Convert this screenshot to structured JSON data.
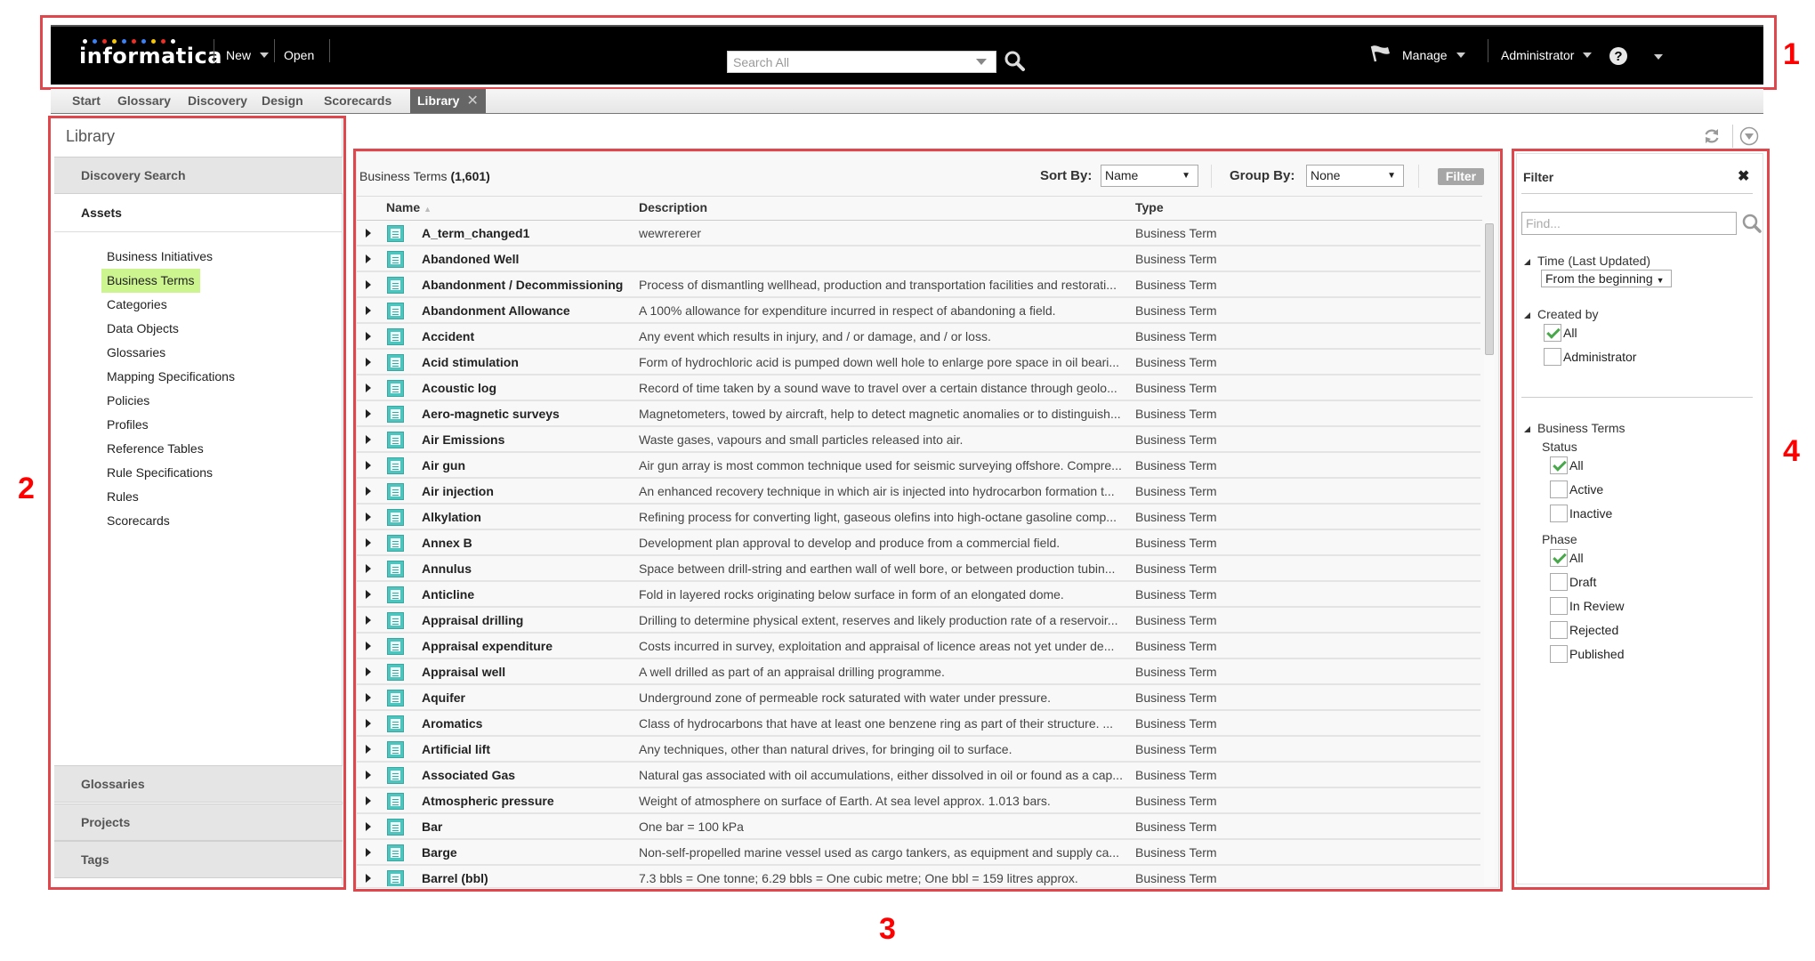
{
  "annotations": {
    "labels": [
      "1",
      "2",
      "3",
      "4"
    ]
  },
  "header": {
    "logo_text": "informatica",
    "logo_dot_colors": [
      "#ffffff",
      "#3b82f6",
      "#ef2e24",
      "#f7c600",
      "#3b82f6",
      "#ef2e24",
      "#3b82f6",
      "#f7c600",
      "#ef2e24",
      "#ffffff"
    ],
    "new_label": "New",
    "open_label": "Open",
    "search_placeholder": "Search All",
    "manage_label": "Manage",
    "user_label": "Administrator",
    "help_icon": "help-icon"
  },
  "tabs": [
    {
      "label": "Start"
    },
    {
      "label": "Glossary"
    },
    {
      "label": "Discovery"
    },
    {
      "label": "Design"
    },
    {
      "label": "Scorecards"
    },
    {
      "label": "Library",
      "active": true,
      "close": "✕"
    }
  ],
  "sidebar": {
    "title": "Library",
    "discovery_search": "Discovery Search",
    "assets": "Assets",
    "asset_items": [
      "Business Initiatives",
      "Business Terms",
      "Categories",
      "Data Objects",
      "Glossaries",
      "Mapping Specifications",
      "Policies",
      "Profiles",
      "Reference Tables",
      "Rule Specifications",
      "Rules",
      "Scorecards"
    ],
    "selected_item": "Business Terms",
    "bottom_sections": [
      "Glossaries",
      "Projects",
      "Tags"
    ],
    "highlight_color": "#ccf58f"
  },
  "main": {
    "title": "Business Terms",
    "count": "(1,601)",
    "sort_by_label": "Sort By:",
    "sort_by_value": "Name",
    "group_by_label": "Group By:",
    "group_by_value": "None",
    "filter_button": "Filter",
    "columns": {
      "name": "Name",
      "description": "Description",
      "type": "Type"
    },
    "rows": [
      {
        "name": "A_term_changed1",
        "description": " wewrererer",
        "type": "Business Term"
      },
      {
        "name": "Abandoned Well",
        "description": "",
        "type": "Business Term"
      },
      {
        "name": "Abandonment / Decommissioning",
        "description": "Process of dismantling wellhead, production and transportation facilities and restorati...",
        "type": "Business Term"
      },
      {
        "name": "Abandonment Allowance",
        "description": "A 100% allowance for expenditure incurred in respect of abandoning a field.",
        "type": "Business Term"
      },
      {
        "name": "Accident",
        "description": " Any event which results in injury, and / or damage, and / or loss.",
        "type": "Business Term"
      },
      {
        "name": "Acid stimulation",
        "description": "Form of hydrochloric acid is pumped down well hole to enlarge pore space in oil beari...",
        "type": "Business Term"
      },
      {
        "name": "Acoustic log",
        "description": "Record of time taken by a sound wave to travel over a certain distance through geolo...",
        "type": "Business Term"
      },
      {
        "name": "Aero-magnetic surveys",
        "description": "Magnetometers, towed by aircraft, help to detect magnetic anomalies or to distinguish...",
        "type": "Business Term"
      },
      {
        "name": "Air Emissions",
        "description": "Waste gases, vapours and small particles released into air.",
        "type": "Business Term"
      },
      {
        "name": "Air gun",
        "description": "Air gun array is most common technique used for seismic surveying offshore. Compre...",
        "type": "Business Term"
      },
      {
        "name": "Air injection",
        "description": "An enhanced recovery technique in which air is injected into hydrocarbon formation t...",
        "type": "Business Term"
      },
      {
        "name": "Alkylation",
        "description": "Refining process for converting light, gaseous olefins into high-octane gasoline comp...",
        "type": "Business Term"
      },
      {
        "name": "Annex B",
        "description": " Development plan approval to develop and produce from a commercial field.",
        "type": "Business Term"
      },
      {
        "name": "Annulus",
        "description": " Space between drill-string and earthen wall of well bore, or between production tubin...",
        "type": "Business Term"
      },
      {
        "name": "Anticline",
        "description": "Fold in layered rocks originating below surface in form of an elongated dome.",
        "type": "Business Term"
      },
      {
        "name": "Appraisal drilling",
        "description": "Drilling to determine physical extent, reserves and likely production rate of a reservoir...",
        "type": "Business Term"
      },
      {
        "name": "Appraisal expenditure",
        "description": "Costs incurred in survey, exploitation and appraisal of licence areas not yet under de...",
        "type": "Business Term"
      },
      {
        "name": "Appraisal well",
        "description": "A well drilled as part of an appraisal drilling programme.",
        "type": "Business Term"
      },
      {
        "name": "Aquifer",
        "description": "Underground zone of permeable rock saturated with water under pressure.",
        "type": "Business Term"
      },
      {
        "name": "Aromatics",
        "description": "Class of hydrocarbons that have at least one benzene ring as part of their structure. ...",
        "type": "Business Term"
      },
      {
        "name": "Artificial lift",
        "description": "Any techniques, other than natural drives, for bringing oil to surface.",
        "type": "Business Term"
      },
      {
        "name": "Associated Gas",
        "description": "Natural gas associated with oil accumulations, either dissolved in oil or found as a cap...",
        "type": "Business Term"
      },
      {
        "name": "Atmospheric pressure",
        "description": "Weight of atmosphere on surface of Earth. At sea level approx. 1.013 bars.",
        "type": "Business Term"
      },
      {
        "name": "Bar",
        "description": "One bar = 100 kPa",
        "type": "Business Term"
      },
      {
        "name": "Barge",
        "description": "Non-self-propelled marine vessel used as cargo tankers, as equipment and supply ca...",
        "type": "Business Term"
      },
      {
        "name": "Barrel (bbl)",
        "description": "7.3 bbls = One tonne; 6.29 bbls = One cubic metre; One bbl = 159 litres approx.",
        "type": "Business Term"
      }
    ]
  },
  "filter": {
    "title": "Filter",
    "close": "✖",
    "find_placeholder": "Find...",
    "time_label": "Time (Last Updated)",
    "time_value": "From the beginning",
    "created_by_label": "Created by",
    "created_by": [
      {
        "label": "All",
        "checked": true
      },
      {
        "label": "Administrator",
        "checked": false
      }
    ],
    "business_terms_label": "Business Terms",
    "status_label": "Status",
    "status": [
      {
        "label": "All",
        "checked": true
      },
      {
        "label": "Active",
        "checked": false
      },
      {
        "label": "Inactive",
        "checked": false
      }
    ],
    "phase_label": "Phase",
    "phase": [
      {
        "label": "All",
        "checked": true
      },
      {
        "label": "Draft",
        "checked": false
      },
      {
        "label": "In Review",
        "checked": false
      },
      {
        "label": "Rejected",
        "checked": false
      },
      {
        "label": "Published",
        "checked": false
      }
    ]
  }
}
